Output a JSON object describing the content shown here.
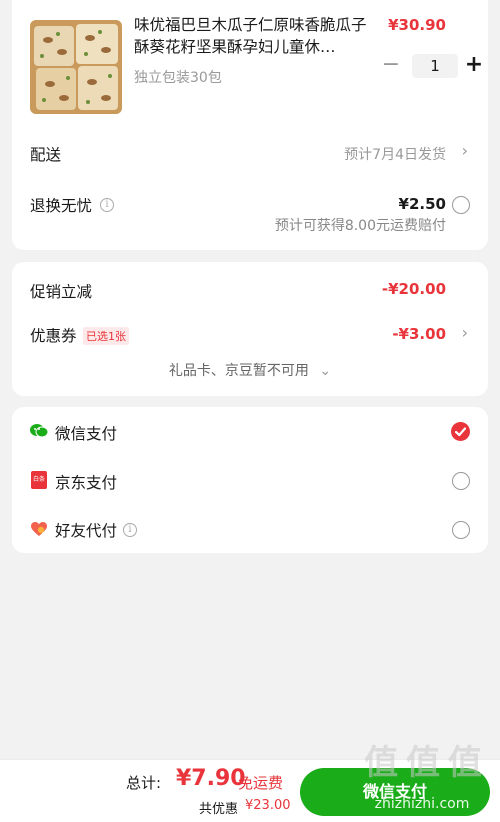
{
  "product": {
    "image_icon": "product-photo-icon",
    "title": "味优福巴旦木瓜子仁原味香脆瓜子酥葵花籽坚果酥孕妇儿童休…",
    "spec": "独立包装30包",
    "price": "¥30.90",
    "quantity": "1",
    "minus": "−",
    "plus": "+"
  },
  "delivery": {
    "label": "配送",
    "value": "预计7月4日发货",
    "chevron": "›"
  },
  "return_worry_free": {
    "label": "退换无忧",
    "info": "i",
    "price": "¥2.50",
    "note": "预计可获得8.00元运费赔付"
  },
  "promotion": {
    "label": "促销立减",
    "value": "-¥20.00"
  },
  "coupon": {
    "label": "优惠券",
    "tag": "已选1张",
    "value": "-¥3.00",
    "chevron": "›"
  },
  "unavailable": {
    "text": "礼品卡、京豆暂不可用",
    "chevron": "⌄"
  },
  "payment_methods": [
    {
      "label": "微信支付",
      "icon": "wechat-pay-icon",
      "selected": true
    },
    {
      "label": "京东支付",
      "icon": "jd-pay-icon",
      "selected": false
    },
    {
      "label": "好友代付",
      "icon": "friend-pay-icon",
      "selected": false,
      "info": "i"
    }
  ],
  "jd_pay_icon_text": "白条",
  "bottom": {
    "total_label": "总计:",
    "total_value": "¥7.90",
    "free_shipping": "免运费",
    "discount_label": "共优惠",
    "discount_value": "¥23.00",
    "pay_button": "微信支付"
  },
  "watermark": {
    "logo_text": "值 值 值",
    "site": "zhizhizhi.com"
  },
  "colors": {
    "accent_red": "#e8343a",
    "wechat_green": "#1aad19"
  }
}
